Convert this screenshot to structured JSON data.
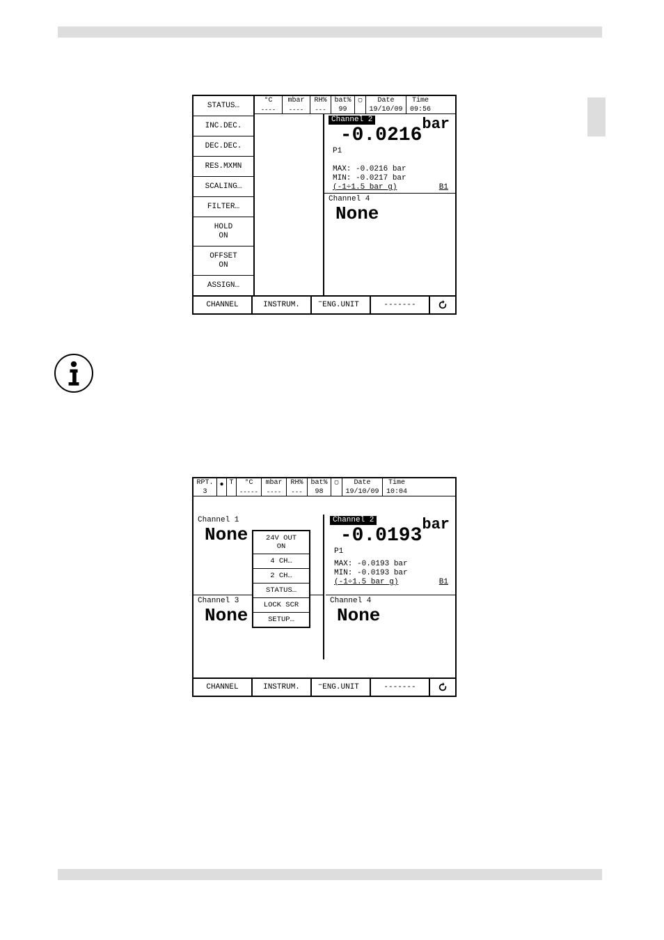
{
  "bars": {},
  "fig1": {
    "left_buttons": [
      "STATUS…",
      "INC.DEC.",
      "DEC.DEC.",
      "RES.MXMN",
      "SCALING…",
      "FILTER…",
      "HOLD\nON",
      "OFFSET\nON",
      "ASSIGN…"
    ],
    "status": {
      "tc_label": "°C",
      "tc_val": "----",
      "mbar_label": "mbar",
      "mbar_val": "----",
      "rh_label": "RH%",
      "rh_val": "---",
      "bat_label": "bat%",
      "bat_val": "99",
      "date_label": "Date",
      "date_val": "19/10/09",
      "time_label": "Time",
      "time_val": "09:56"
    },
    "ch2": {
      "label": "Channel 2",
      "unit": "bar",
      "value": "-0.0216",
      "p1": "P1",
      "max": "MAX:   -0.0216 bar",
      "min": "MIN:   -0.0217 bar",
      "range": "(-1÷1.5 bar g)",
      "b1": "B1"
    },
    "ch4": {
      "label": "Channel 4",
      "value": "None"
    },
    "footer": [
      "CHANNEL",
      "INSTRUM.",
      "ENG.UNIT",
      "-------"
    ]
  },
  "caption1_prefix": "–",
  "fig2": {
    "status": {
      "rpt": "RPT.",
      "rpt_n": "3",
      "t_label": "T",
      "tc_label": "°C",
      "tc_val": "-----",
      "mbar_label": "mbar",
      "mbar_val": "----",
      "rh_label": "RH%",
      "rh_val": "---",
      "bat_label": "bat%",
      "bat_val": "98",
      "date_label": "Date",
      "date_val": "19/10/09",
      "time_label": "Time",
      "time_val": "10:04"
    },
    "ch1": {
      "label": "Channel 1",
      "value": "None"
    },
    "ch2": {
      "label": "Channel 2",
      "unit": "bar",
      "value": "-0.0193",
      "p1": "P1",
      "max": "MAX:   -0.0193 bar",
      "min": "MIN:   -0.0193 bar",
      "range": "(-1÷1.5 bar g)",
      "b1": "B1"
    },
    "ch3": {
      "label": "Channel 3",
      "value": "None"
    },
    "ch4": {
      "label": "Channel 4",
      "value": "None"
    },
    "popup": [
      "24V OUT\nON",
      "4 CH…",
      "2 CH…",
      "STATUS…",
      "LOCK SCR",
      "SETUP…"
    ],
    "footer": [
      "CHANNEL",
      "INSTRUM.",
      "ENG.UNIT",
      "-------"
    ]
  },
  "caption2_prefix": "–"
}
